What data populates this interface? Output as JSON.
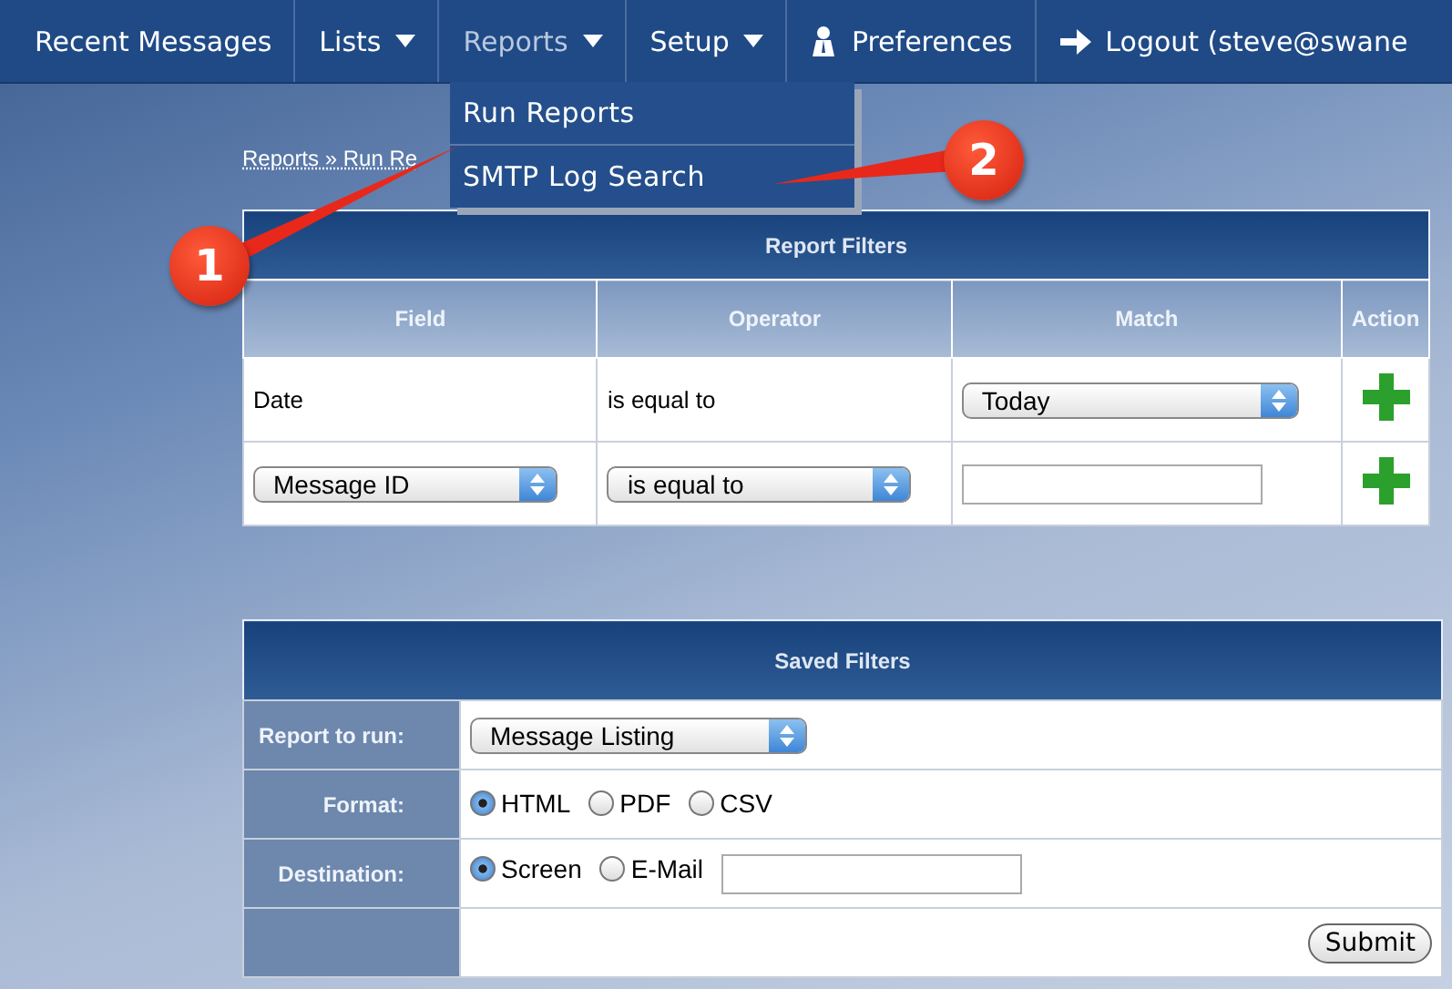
{
  "nav": {
    "items": [
      {
        "label": "Recent Messages",
        "kind": "link",
        "expanded": false
      },
      {
        "label": "Lists",
        "kind": "menu",
        "expanded": false
      },
      {
        "label": "Reports",
        "kind": "menu",
        "expanded": true
      },
      {
        "label": "Setup",
        "kind": "menu",
        "expanded": false
      },
      {
        "label": "Preferences",
        "kind": "user-link",
        "expanded": false
      },
      {
        "label": "Logout (steve@swane",
        "kind": "logout-link",
        "expanded": false
      }
    ],
    "dropdown": [
      "Run Reports",
      "SMTP Log Search"
    ]
  },
  "breadcrumb": "Reports » Run Re",
  "annotations": [
    {
      "label": "1"
    },
    {
      "label": "2"
    }
  ],
  "report_filters": {
    "title": "Report Filters",
    "columns": [
      "Field",
      "Operator",
      "Match",
      "Action"
    ],
    "rows": [
      [
        {
          "kind": "text",
          "value": "Date"
        },
        {
          "kind": "text",
          "value": "is equal to"
        },
        {
          "kind": "select",
          "value": "Today"
        },
        {
          "kind": "add"
        }
      ],
      [
        {
          "kind": "select",
          "value": "Message ID"
        },
        {
          "kind": "select",
          "value": "is equal to"
        },
        {
          "kind": "input"
        },
        {
          "kind": "add"
        }
      ]
    ]
  },
  "saved_filters": {
    "title": "Saved Filters",
    "rows": [
      {
        "label": "Report to run:",
        "kind": "select",
        "value": "Message Listing"
      },
      {
        "label": "Format:",
        "kind": "radios",
        "options": [
          {
            "label": "HTML",
            "selected": true
          },
          {
            "label": "PDF",
            "selected": false
          },
          {
            "label": "CSV",
            "selected": false
          }
        ]
      },
      {
        "label": "Destination:",
        "kind": "radios-input",
        "options": [
          {
            "label": "Screen",
            "selected": true
          },
          {
            "label": "E-Mail",
            "selected": false
          }
        ]
      },
      {
        "kind": "submit",
        "button": "Submit"
      }
    ]
  }
}
